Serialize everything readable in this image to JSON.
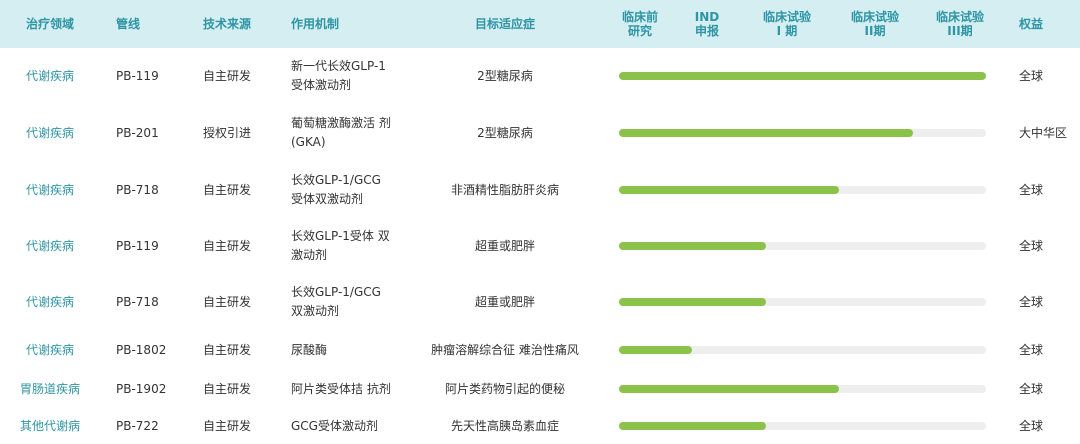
{
  "colors": {
    "header_bg": "#d4eef2",
    "header_text": "#2f95a5",
    "area_text": "#2f95a5",
    "bar_fill": "#8bc34a",
    "bar_track": "#eeeeee"
  },
  "header": {
    "area": "治疗领域",
    "pipeline": "管线",
    "source": "技术来源",
    "mechanism": "作用机制",
    "indication": "目标适应症",
    "stage_preclinical": "临床前\n研究",
    "stage_ind": "IND\n申报",
    "stage_phase1": "临床试验\nI 期",
    "stage_phase2": "临床试验\nII期",
    "stage_phase3": "临床试验\nIII期",
    "rights": "权益"
  },
  "rows": [
    {
      "area": "代谢疾病",
      "pipeline": "PB-119",
      "source": "自主研发",
      "mechanism": "新一代长效GLP-1\n受体激动剂",
      "indication": "2型糖尿病",
      "progress": 1.0,
      "rights": "全球"
    },
    {
      "area": "代谢疾病",
      "pipeline": "PB-201",
      "source": "授权引进",
      "mechanism": "葡萄糖激酶激活 剂\n(GKA)",
      "indication": "2型糖尿病",
      "progress": 0.8,
      "rights": "大中华区"
    },
    {
      "area": "代谢疾病",
      "pipeline": "PB-718",
      "source": "自主研发",
      "mechanism": "长效GLP-1/GCG\n受体双激动剂",
      "indication": "非酒精性脂肪肝炎病",
      "progress": 0.6,
      "rights": "全球"
    },
    {
      "area": "代谢疾病",
      "pipeline": "PB-119",
      "source": "自主研发",
      "mechanism": "长效GLP-1受体 双\n激动剂",
      "indication": "超重或肥胖",
      "progress": 0.4,
      "rights": "全球"
    },
    {
      "area": "代谢疾病",
      "pipeline": "PB-718",
      "source": "自主研发",
      "mechanism": "长效GLP-1/GCG\n双激动剂",
      "indication": "超重或肥胖",
      "progress": 0.4,
      "rights": "全球"
    },
    {
      "area": "代谢疾病",
      "pipeline": "PB-1802",
      "source": "自主研发",
      "mechanism": "尿酸酶",
      "indication": "肿瘤溶解综合征 难治性痛风",
      "progress": 0.2,
      "rights": "全球"
    },
    {
      "area": "胃肠道疾病",
      "pipeline": "PB-1902",
      "source": "自主研发",
      "mechanism": "阿片类受体拮 抗剂",
      "indication": "阿片类药物引起的便秘",
      "progress": 0.6,
      "rights": "全球"
    },
    {
      "area": "其他代谢病",
      "pipeline": "PB-722",
      "source": "自主研发",
      "mechanism": "GCG受体激动剂",
      "indication": "先天性高胰岛素血症",
      "progress": 0.4,
      "rights": "全球"
    }
  ]
}
